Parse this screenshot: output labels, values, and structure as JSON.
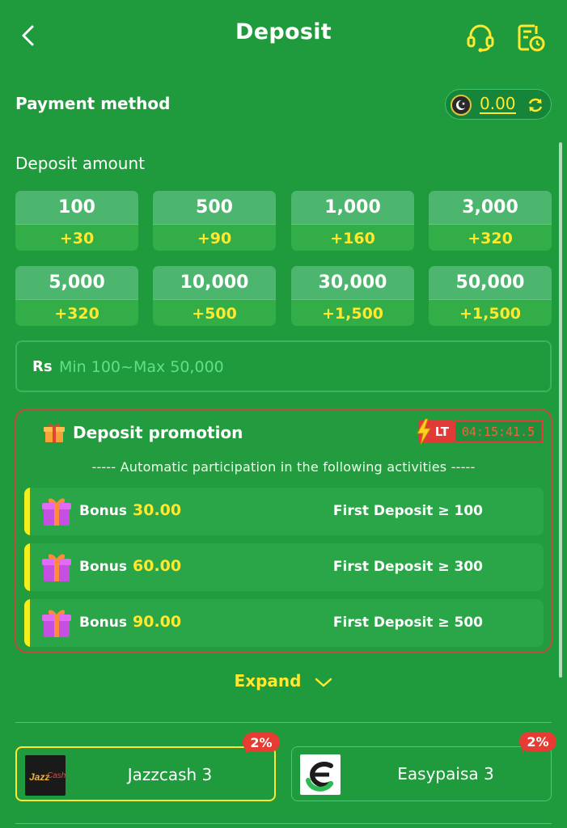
{
  "header": {
    "title": "Deposit",
    "back_icon": "back-arrow-icon",
    "support_icon": "headset-icon",
    "record_icon": "deposit-record-icon"
  },
  "payment": {
    "label": "Payment method",
    "balance": "0.00",
    "flag_icon": "pakistan-flag-icon",
    "refresh_icon": "refresh-icon"
  },
  "amount": {
    "label": "Deposit amount",
    "options": [
      {
        "value": "100",
        "bonus": "+30"
      },
      {
        "value": "500",
        "bonus": "+90"
      },
      {
        "value": "1,000",
        "bonus": "+160"
      },
      {
        "value": "3,000",
        "bonus": "+320"
      },
      {
        "value": "5,000",
        "bonus": "+320"
      },
      {
        "value": "10,000",
        "bonus": "+500"
      },
      {
        "value": "30,000",
        "bonus": "+1,500"
      },
      {
        "value": "50,000",
        "bonus": "+1,500"
      }
    ],
    "currency": "Rs",
    "placeholder": "Min 100~Max 50,000",
    "value": ""
  },
  "promotion": {
    "title": "Deposit promotion",
    "badge": "LT",
    "timer": "04:15:41.5",
    "subtitle": "----- Automatic participation in the following activities -----",
    "rows": [
      {
        "label": "Bonus",
        "amount": "30.00",
        "condition": "First Deposit ≥ 100"
      },
      {
        "label": "Bonus",
        "amount": "60.00",
        "condition": "First Deposit ≥ 300"
      },
      {
        "label": "Bonus",
        "amount": "90.00",
        "condition": "First Deposit ≥ 500"
      }
    ],
    "expand": "Expand"
  },
  "channels": [
    {
      "name": "Jazzcash 3",
      "fee": "2%",
      "selected": true,
      "logo": "jazzcash-logo"
    },
    {
      "name": "Easypaisa 3",
      "fee": "2%",
      "selected": false,
      "logo": "easypaisa-logo"
    }
  ],
  "colors": {
    "background": "#1f9a3c",
    "accent": "#ffe82e",
    "badge_red": "#e63c33"
  }
}
